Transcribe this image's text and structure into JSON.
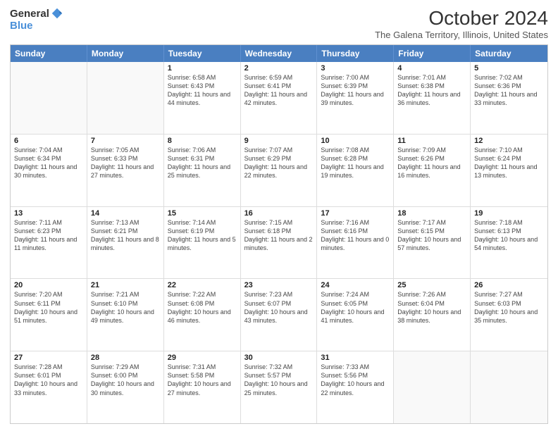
{
  "logo": {
    "general": "General",
    "blue": "Blue"
  },
  "header": {
    "month": "October 2024",
    "location": "The Galena Territory, Illinois, United States"
  },
  "days_of_week": [
    "Sunday",
    "Monday",
    "Tuesday",
    "Wednesday",
    "Thursday",
    "Friday",
    "Saturday"
  ],
  "weeks": [
    [
      {
        "day": "",
        "sunrise": "",
        "sunset": "",
        "daylight": ""
      },
      {
        "day": "",
        "sunrise": "",
        "sunset": "",
        "daylight": ""
      },
      {
        "day": "1",
        "sunrise": "Sunrise: 6:58 AM",
        "sunset": "Sunset: 6:43 PM",
        "daylight": "Daylight: 11 hours and 44 minutes."
      },
      {
        "day": "2",
        "sunrise": "Sunrise: 6:59 AM",
        "sunset": "Sunset: 6:41 PM",
        "daylight": "Daylight: 11 hours and 42 minutes."
      },
      {
        "day": "3",
        "sunrise": "Sunrise: 7:00 AM",
        "sunset": "Sunset: 6:39 PM",
        "daylight": "Daylight: 11 hours and 39 minutes."
      },
      {
        "day": "4",
        "sunrise": "Sunrise: 7:01 AM",
        "sunset": "Sunset: 6:38 PM",
        "daylight": "Daylight: 11 hours and 36 minutes."
      },
      {
        "day": "5",
        "sunrise": "Sunrise: 7:02 AM",
        "sunset": "Sunset: 6:36 PM",
        "daylight": "Daylight: 11 hours and 33 minutes."
      }
    ],
    [
      {
        "day": "6",
        "sunrise": "Sunrise: 7:04 AM",
        "sunset": "Sunset: 6:34 PM",
        "daylight": "Daylight: 11 hours and 30 minutes."
      },
      {
        "day": "7",
        "sunrise": "Sunrise: 7:05 AM",
        "sunset": "Sunset: 6:33 PM",
        "daylight": "Daylight: 11 hours and 27 minutes."
      },
      {
        "day": "8",
        "sunrise": "Sunrise: 7:06 AM",
        "sunset": "Sunset: 6:31 PM",
        "daylight": "Daylight: 11 hours and 25 minutes."
      },
      {
        "day": "9",
        "sunrise": "Sunrise: 7:07 AM",
        "sunset": "Sunset: 6:29 PM",
        "daylight": "Daylight: 11 hours and 22 minutes."
      },
      {
        "day": "10",
        "sunrise": "Sunrise: 7:08 AM",
        "sunset": "Sunset: 6:28 PM",
        "daylight": "Daylight: 11 hours and 19 minutes."
      },
      {
        "day": "11",
        "sunrise": "Sunrise: 7:09 AM",
        "sunset": "Sunset: 6:26 PM",
        "daylight": "Daylight: 11 hours and 16 minutes."
      },
      {
        "day": "12",
        "sunrise": "Sunrise: 7:10 AM",
        "sunset": "Sunset: 6:24 PM",
        "daylight": "Daylight: 11 hours and 13 minutes."
      }
    ],
    [
      {
        "day": "13",
        "sunrise": "Sunrise: 7:11 AM",
        "sunset": "Sunset: 6:23 PM",
        "daylight": "Daylight: 11 hours and 11 minutes."
      },
      {
        "day": "14",
        "sunrise": "Sunrise: 7:13 AM",
        "sunset": "Sunset: 6:21 PM",
        "daylight": "Daylight: 11 hours and 8 minutes."
      },
      {
        "day": "15",
        "sunrise": "Sunrise: 7:14 AM",
        "sunset": "Sunset: 6:19 PM",
        "daylight": "Daylight: 11 hours and 5 minutes."
      },
      {
        "day": "16",
        "sunrise": "Sunrise: 7:15 AM",
        "sunset": "Sunset: 6:18 PM",
        "daylight": "Daylight: 11 hours and 2 minutes."
      },
      {
        "day": "17",
        "sunrise": "Sunrise: 7:16 AM",
        "sunset": "Sunset: 6:16 PM",
        "daylight": "Daylight: 11 hours and 0 minutes."
      },
      {
        "day": "18",
        "sunrise": "Sunrise: 7:17 AM",
        "sunset": "Sunset: 6:15 PM",
        "daylight": "Daylight: 10 hours and 57 minutes."
      },
      {
        "day": "19",
        "sunrise": "Sunrise: 7:18 AM",
        "sunset": "Sunset: 6:13 PM",
        "daylight": "Daylight: 10 hours and 54 minutes."
      }
    ],
    [
      {
        "day": "20",
        "sunrise": "Sunrise: 7:20 AM",
        "sunset": "Sunset: 6:11 PM",
        "daylight": "Daylight: 10 hours and 51 minutes."
      },
      {
        "day": "21",
        "sunrise": "Sunrise: 7:21 AM",
        "sunset": "Sunset: 6:10 PM",
        "daylight": "Daylight: 10 hours and 49 minutes."
      },
      {
        "day": "22",
        "sunrise": "Sunrise: 7:22 AM",
        "sunset": "Sunset: 6:08 PM",
        "daylight": "Daylight: 10 hours and 46 minutes."
      },
      {
        "day": "23",
        "sunrise": "Sunrise: 7:23 AM",
        "sunset": "Sunset: 6:07 PM",
        "daylight": "Daylight: 10 hours and 43 minutes."
      },
      {
        "day": "24",
        "sunrise": "Sunrise: 7:24 AM",
        "sunset": "Sunset: 6:05 PM",
        "daylight": "Daylight: 10 hours and 41 minutes."
      },
      {
        "day": "25",
        "sunrise": "Sunrise: 7:26 AM",
        "sunset": "Sunset: 6:04 PM",
        "daylight": "Daylight: 10 hours and 38 minutes."
      },
      {
        "day": "26",
        "sunrise": "Sunrise: 7:27 AM",
        "sunset": "Sunset: 6:03 PM",
        "daylight": "Daylight: 10 hours and 35 minutes."
      }
    ],
    [
      {
        "day": "27",
        "sunrise": "Sunrise: 7:28 AM",
        "sunset": "Sunset: 6:01 PM",
        "daylight": "Daylight: 10 hours and 33 minutes."
      },
      {
        "day": "28",
        "sunrise": "Sunrise: 7:29 AM",
        "sunset": "Sunset: 6:00 PM",
        "daylight": "Daylight: 10 hours and 30 minutes."
      },
      {
        "day": "29",
        "sunrise": "Sunrise: 7:31 AM",
        "sunset": "Sunset: 5:58 PM",
        "daylight": "Daylight: 10 hours and 27 minutes."
      },
      {
        "day": "30",
        "sunrise": "Sunrise: 7:32 AM",
        "sunset": "Sunset: 5:57 PM",
        "daylight": "Daylight: 10 hours and 25 minutes."
      },
      {
        "day": "31",
        "sunrise": "Sunrise: 7:33 AM",
        "sunset": "Sunset: 5:56 PM",
        "daylight": "Daylight: 10 hours and 22 minutes."
      },
      {
        "day": "",
        "sunrise": "",
        "sunset": "",
        "daylight": ""
      },
      {
        "day": "",
        "sunrise": "",
        "sunset": "",
        "daylight": ""
      }
    ]
  ]
}
